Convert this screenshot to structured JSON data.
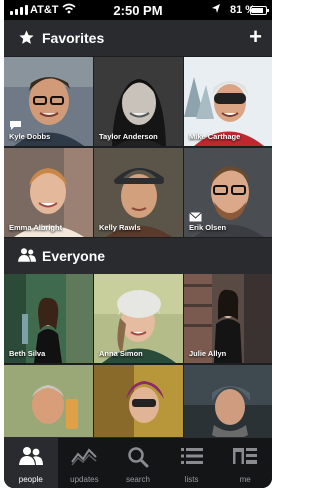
{
  "status": {
    "carrier": "AT&T",
    "time": "2:50 PM",
    "battery": "81 %"
  },
  "favorites": {
    "title": "Favorites",
    "people": [
      {
        "name": "Kyle Dobbs",
        "badge": "chat"
      },
      {
        "name": "Taylor Anderson"
      },
      {
        "name": "Mike Carthage"
      },
      {
        "name": "Emma Albright"
      },
      {
        "name": "Kelly Rawls"
      },
      {
        "name": "Erik Olsen",
        "badge": "mail"
      }
    ]
  },
  "everyone": {
    "title": "Everyone",
    "people": [
      {
        "name": "Beth Silva"
      },
      {
        "name": "Anna Simon"
      },
      {
        "name": "Julie Allyn"
      },
      {
        "name": ""
      },
      {
        "name": ""
      },
      {
        "name": ""
      }
    ]
  },
  "tabs": [
    {
      "label": "people",
      "icon": "people-icon",
      "active": true
    },
    {
      "label": "updates",
      "icon": "updates-icon"
    },
    {
      "label": "search",
      "icon": "search-icon"
    },
    {
      "label": "lists",
      "icon": "lists-icon"
    },
    {
      "label": "me",
      "icon": "me-icon"
    }
  ]
}
